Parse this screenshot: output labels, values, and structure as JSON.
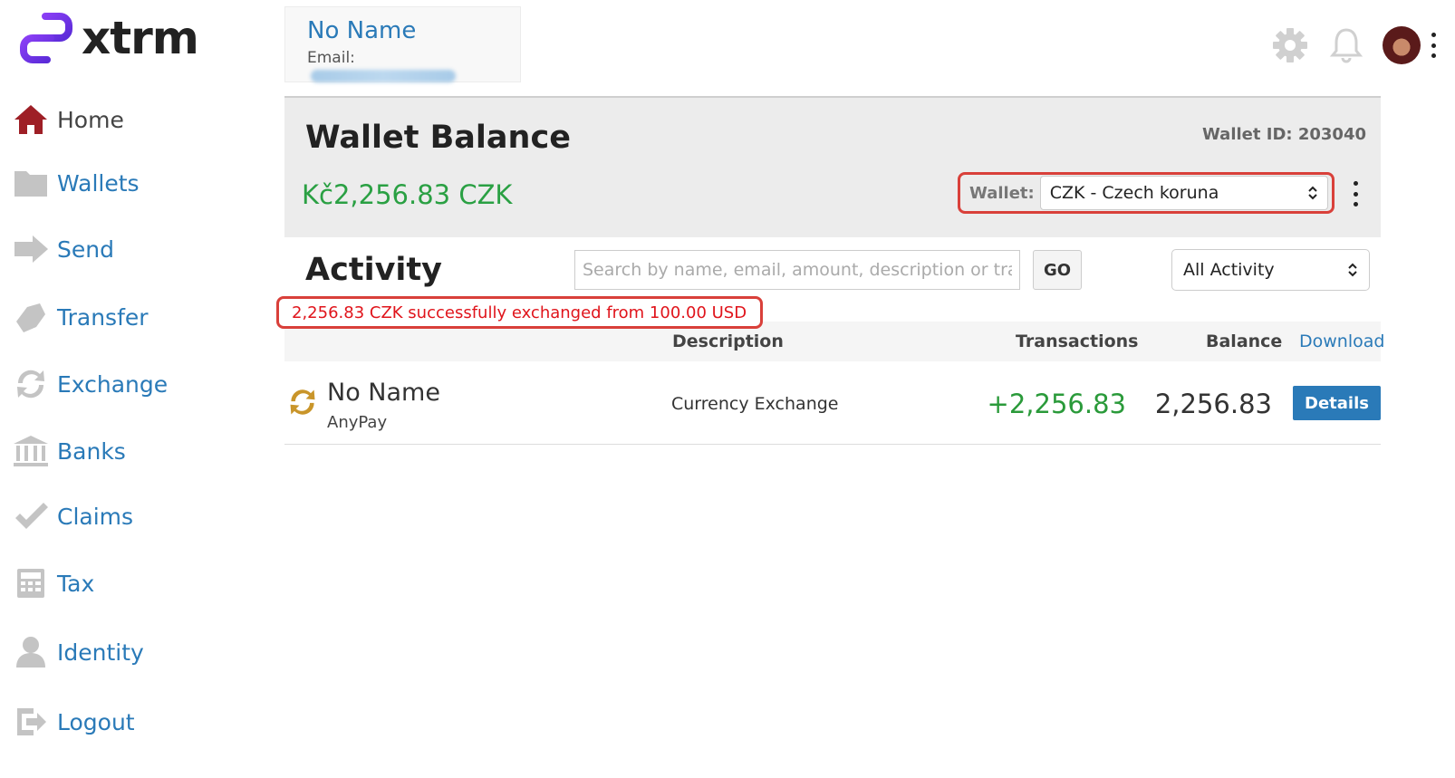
{
  "brand": {
    "name": "xtrm"
  },
  "sidebar": {
    "items": [
      {
        "label": "Home",
        "icon": "home-icon"
      },
      {
        "label": "Wallets",
        "icon": "folder-icon"
      },
      {
        "label": "Send",
        "icon": "send-arrow-icon"
      },
      {
        "label": "Transfer",
        "icon": "transfer-icon"
      },
      {
        "label": "Exchange",
        "icon": "exchange-icon"
      },
      {
        "label": "Banks",
        "icon": "bank-icon"
      },
      {
        "label": "Claims",
        "icon": "checkmark-icon"
      },
      {
        "label": "Tax",
        "icon": "calculator-icon"
      },
      {
        "label": "Identity",
        "icon": "user-icon"
      },
      {
        "label": "Logout",
        "icon": "logout-icon"
      }
    ]
  },
  "profile": {
    "name": "No Name",
    "email_label": "Email:"
  },
  "header": {
    "icons": [
      "gear-icon",
      "bell-icon",
      "avatar",
      "kebab-menu-icon"
    ]
  },
  "wallet": {
    "title": "Wallet Balance",
    "id_text": "Wallet ID: 203040",
    "balance": "Kč2,256.83 CZK",
    "select_label": "Wallet:",
    "selected": "CZK - Czech koruna"
  },
  "activity": {
    "title": "Activity",
    "search_placeholder": "Search by name, email, amount, description or transa",
    "go_label": "GO",
    "filter_selected": "All Activity",
    "notice": "2,256.83 CZK successfully exchanged from 100.00 USD",
    "columns": {
      "description": "Description",
      "transactions": "Transactions",
      "balance": "Balance",
      "download": "Download"
    },
    "rows": [
      {
        "name": "No Name",
        "sub": "AnyPay",
        "description": "Currency Exchange",
        "transaction": "+2,256.83",
        "balance": "2,256.83",
        "action": "Details"
      }
    ]
  },
  "colors": {
    "accent_blue": "#2a7ab8",
    "positive_green": "#2aa043",
    "alert_red": "#e0141b",
    "brand_purple": "#7b3ff2"
  }
}
